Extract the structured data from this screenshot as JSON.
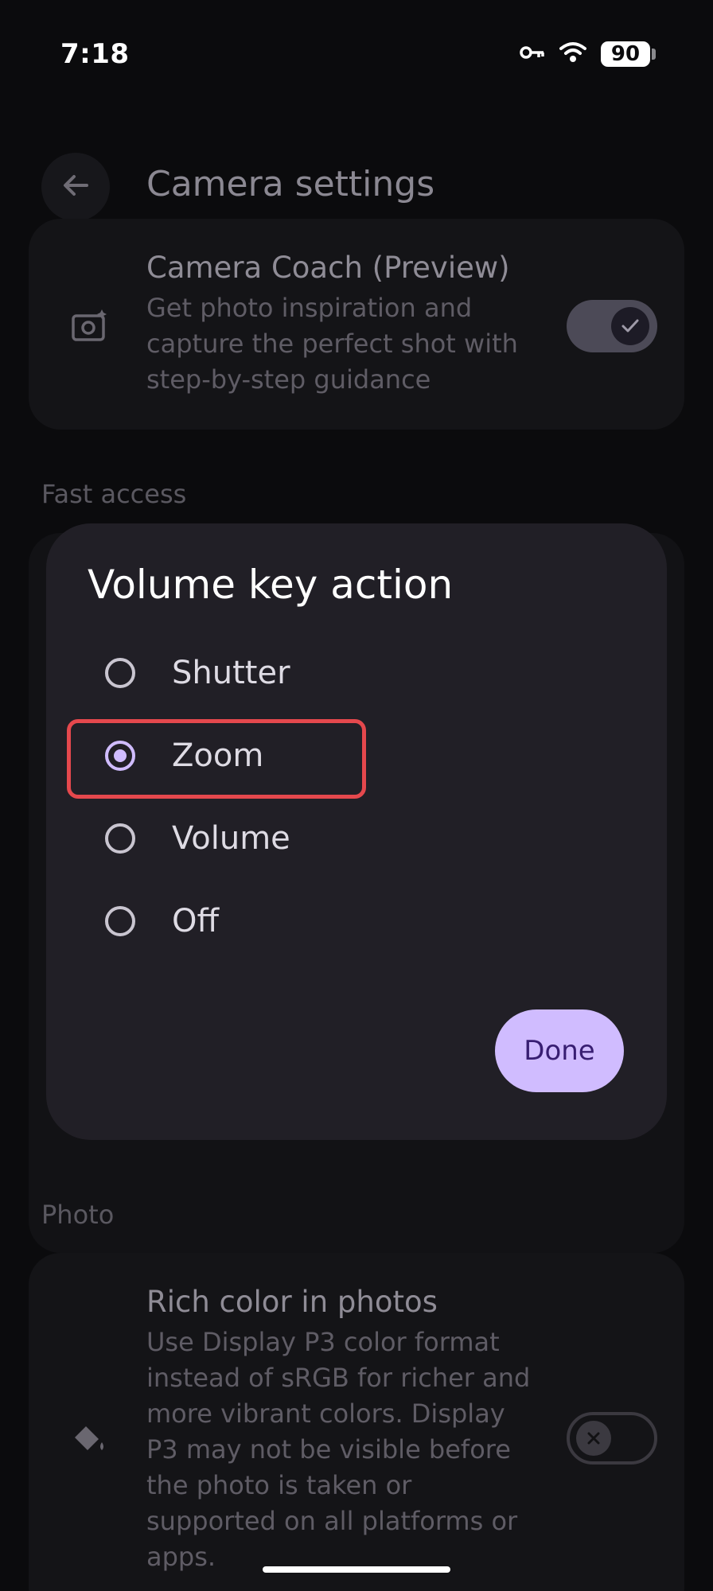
{
  "status_bar": {
    "time": "7:18",
    "battery": "90",
    "icons": [
      "vpn-key-icon",
      "wifi-icon",
      "battery-icon"
    ]
  },
  "header": {
    "title": "Camera settings",
    "back_icon": "arrow-back-icon"
  },
  "camera_coach": {
    "title": "Camera Coach (Preview)",
    "description": "Get photo inspiration and capture the perfect shot with step-by-step guidance",
    "enabled": true,
    "icon": "camera-sparkle-icon"
  },
  "sections": {
    "fast_access": "Fast access",
    "photo": "Photo"
  },
  "rich_color": {
    "title": "Rich color in photos",
    "description": "Use Display P3 color format instead of sRGB for richer and more vibrant colors. Display P3 may not be visible before the photo is taken or supported on all platforms or apps.",
    "enabled": false,
    "icon": "paint-bucket-icon"
  },
  "dialog": {
    "title": "Volume key action",
    "options": [
      {
        "label": "Shutter",
        "selected": false
      },
      {
        "label": "Zoom",
        "selected": true
      },
      {
        "label": "Volume",
        "selected": false
      },
      {
        "label": "Off",
        "selected": false
      }
    ],
    "done_label": "Done"
  },
  "colors": {
    "accent": "#d0bcff",
    "highlight": "#e5484d",
    "dialog_bg": "#211f26"
  }
}
